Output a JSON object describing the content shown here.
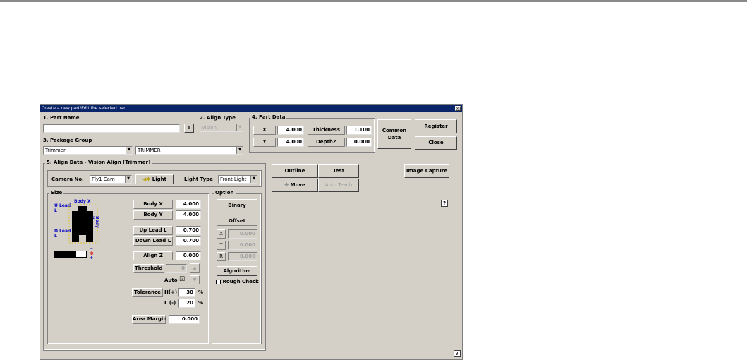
{
  "window": {
    "title": "Create a new part/Edit the selected part",
    "close_icon": "close-icon"
  },
  "part_name": {
    "label": "1. Part Name",
    "value": "",
    "button": "!"
  },
  "align_type": {
    "label": "2. Align Type",
    "value": "Vision"
  },
  "package_group": {
    "label": "3. Package Group",
    "group": "Trimmer",
    "name": "TRIMMER"
  },
  "part_data": {
    "label": "4. Part Data",
    "x_label": "X",
    "x_value": "4.000",
    "y_label": "Y",
    "y_value": "4.000",
    "thickness_label": "Thickness",
    "thickness_value": "1.100",
    "depthz_label": "DepthZ",
    "depthz_value": "0.000"
  },
  "buttons": {
    "common_data": "Common Data",
    "register": "Register",
    "close": "Close"
  },
  "align_data": {
    "title": "5. Align Data - Vision Align [Trimmer]",
    "camera_label": "Camera No.",
    "camera_value": "Fly1 Cam",
    "light_button": "Light",
    "light_type_label": "Light Type",
    "light_type_value": "Front Light"
  },
  "size": {
    "title": "Size",
    "diagram": {
      "body_x": "Body X",
      "u_lead": "U Lead",
      "u_lead_l": "L",
      "d_lead": "D Lead",
      "d_lead_l": "L",
      "body_y": "Body Y"
    },
    "scale_minus": "−",
    "scale_zero": "0",
    "scale_plus": "+",
    "body_x_label": "Body X",
    "body_x_value": "4.000",
    "body_y_label": "Body Y",
    "body_y_value": "4.000",
    "up_lead_label": "Up Lead L",
    "up_lead_value": "0.700",
    "down_lead_label": "Down Lead L",
    "down_lead_value": "0.700",
    "align_z_label": "Align Z",
    "align_z_value": "0.000",
    "threshold_label": "Threshold",
    "threshold_value": "0",
    "auto_label": "Auto",
    "auto_checked": "☑",
    "tolerance_label": "Tolerance",
    "h_label": "H(+)",
    "h_value": "30",
    "l_label": "L (-)",
    "l_value": "20",
    "percent": "%",
    "area_margin_label": "Area Margin",
    "area_margin_value": "0.000"
  },
  "option": {
    "title": "Option",
    "binary": "Binary",
    "offset": "Offset",
    "x_label": "X",
    "x_value": "0.000",
    "y_label": "Y",
    "y_value": "0.000",
    "r_label": "R",
    "r_value": "0.000",
    "algorithm": "Algorithm",
    "rough_check": "Rough Check"
  },
  "toolbar": {
    "outline": "Outline",
    "test": "Test",
    "move": "Move",
    "auto_teach": "Auto Teach",
    "image_capture": "Image Capture"
  },
  "help": "?"
}
